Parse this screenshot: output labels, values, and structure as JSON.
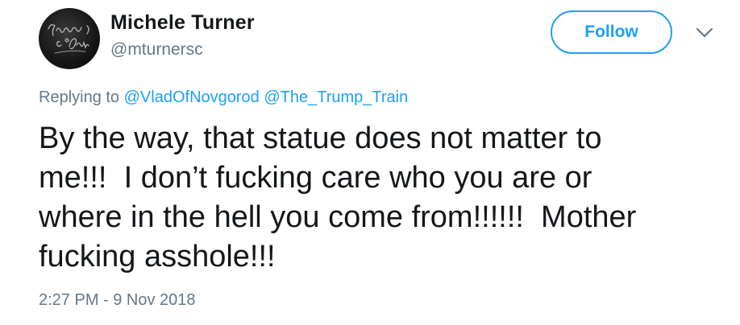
{
  "user": {
    "display_name": "Michele Turner",
    "username": "@mturnersc",
    "avatar_text": "Liberty or Death"
  },
  "actions": {
    "follow_label": "Follow",
    "menu_icon": "chevron-down-icon"
  },
  "reply": {
    "prefix": "Replying to",
    "mentions": [
      "@VladOfNovgorod",
      "@The_Trump_Train"
    ]
  },
  "tweet": {
    "lines": [
      "By the way, that statue does not matter to",
      "me!!!  I don’t fucking care who you are or",
      "where in the hell you come from!!!!!!  Mother",
      "fucking asshole!!!"
    ],
    "timestamp": "2:27 PM - 9 Nov 2018"
  },
  "colors": {
    "accent": "#1da1f2",
    "text": "#14171a",
    "secondary": "#657786"
  }
}
